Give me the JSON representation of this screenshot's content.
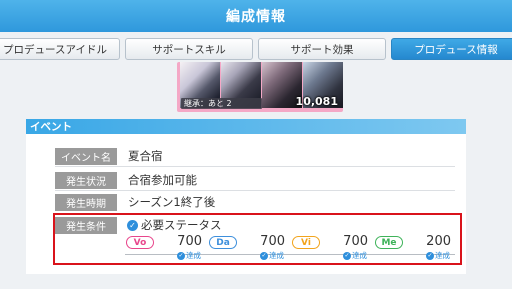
{
  "header": {
    "title": "編成情報"
  },
  "tabs": [
    {
      "label": "プロデュースアイドル"
    },
    {
      "label": "サポートスキル"
    },
    {
      "label": "サポート効果"
    },
    {
      "label": "プロデュース情報"
    }
  ],
  "card_strip": {
    "inherit_label": "継承：あと 2",
    "fans": "10,081"
  },
  "event": {
    "section_title": "イベント",
    "rows": [
      {
        "label": "イベント名",
        "value": "夏合宿"
      },
      {
        "label": "発生状況",
        "value": "合宿参加可能"
      },
      {
        "label": "発生時期",
        "value": "シーズン1終了後"
      },
      {
        "label": "発生条件",
        "value": "必要ステータス"
      }
    ],
    "stats": [
      {
        "name": "Vo",
        "value": "700",
        "status": "達成",
        "color": "#e8468c"
      },
      {
        "name": "Da",
        "value": "700",
        "status": "達成",
        "color": "#3d8fdc"
      },
      {
        "name": "Vi",
        "value": "700",
        "status": "達成",
        "color": "#f2a41c"
      },
      {
        "name": "Me",
        "value": "200",
        "status": "達成",
        "color": "#3fb35a"
      }
    ]
  },
  "colors": {
    "header": "#2f98dc",
    "active_tab": "#2588cf",
    "highlight_border": "#d9131b"
  }
}
